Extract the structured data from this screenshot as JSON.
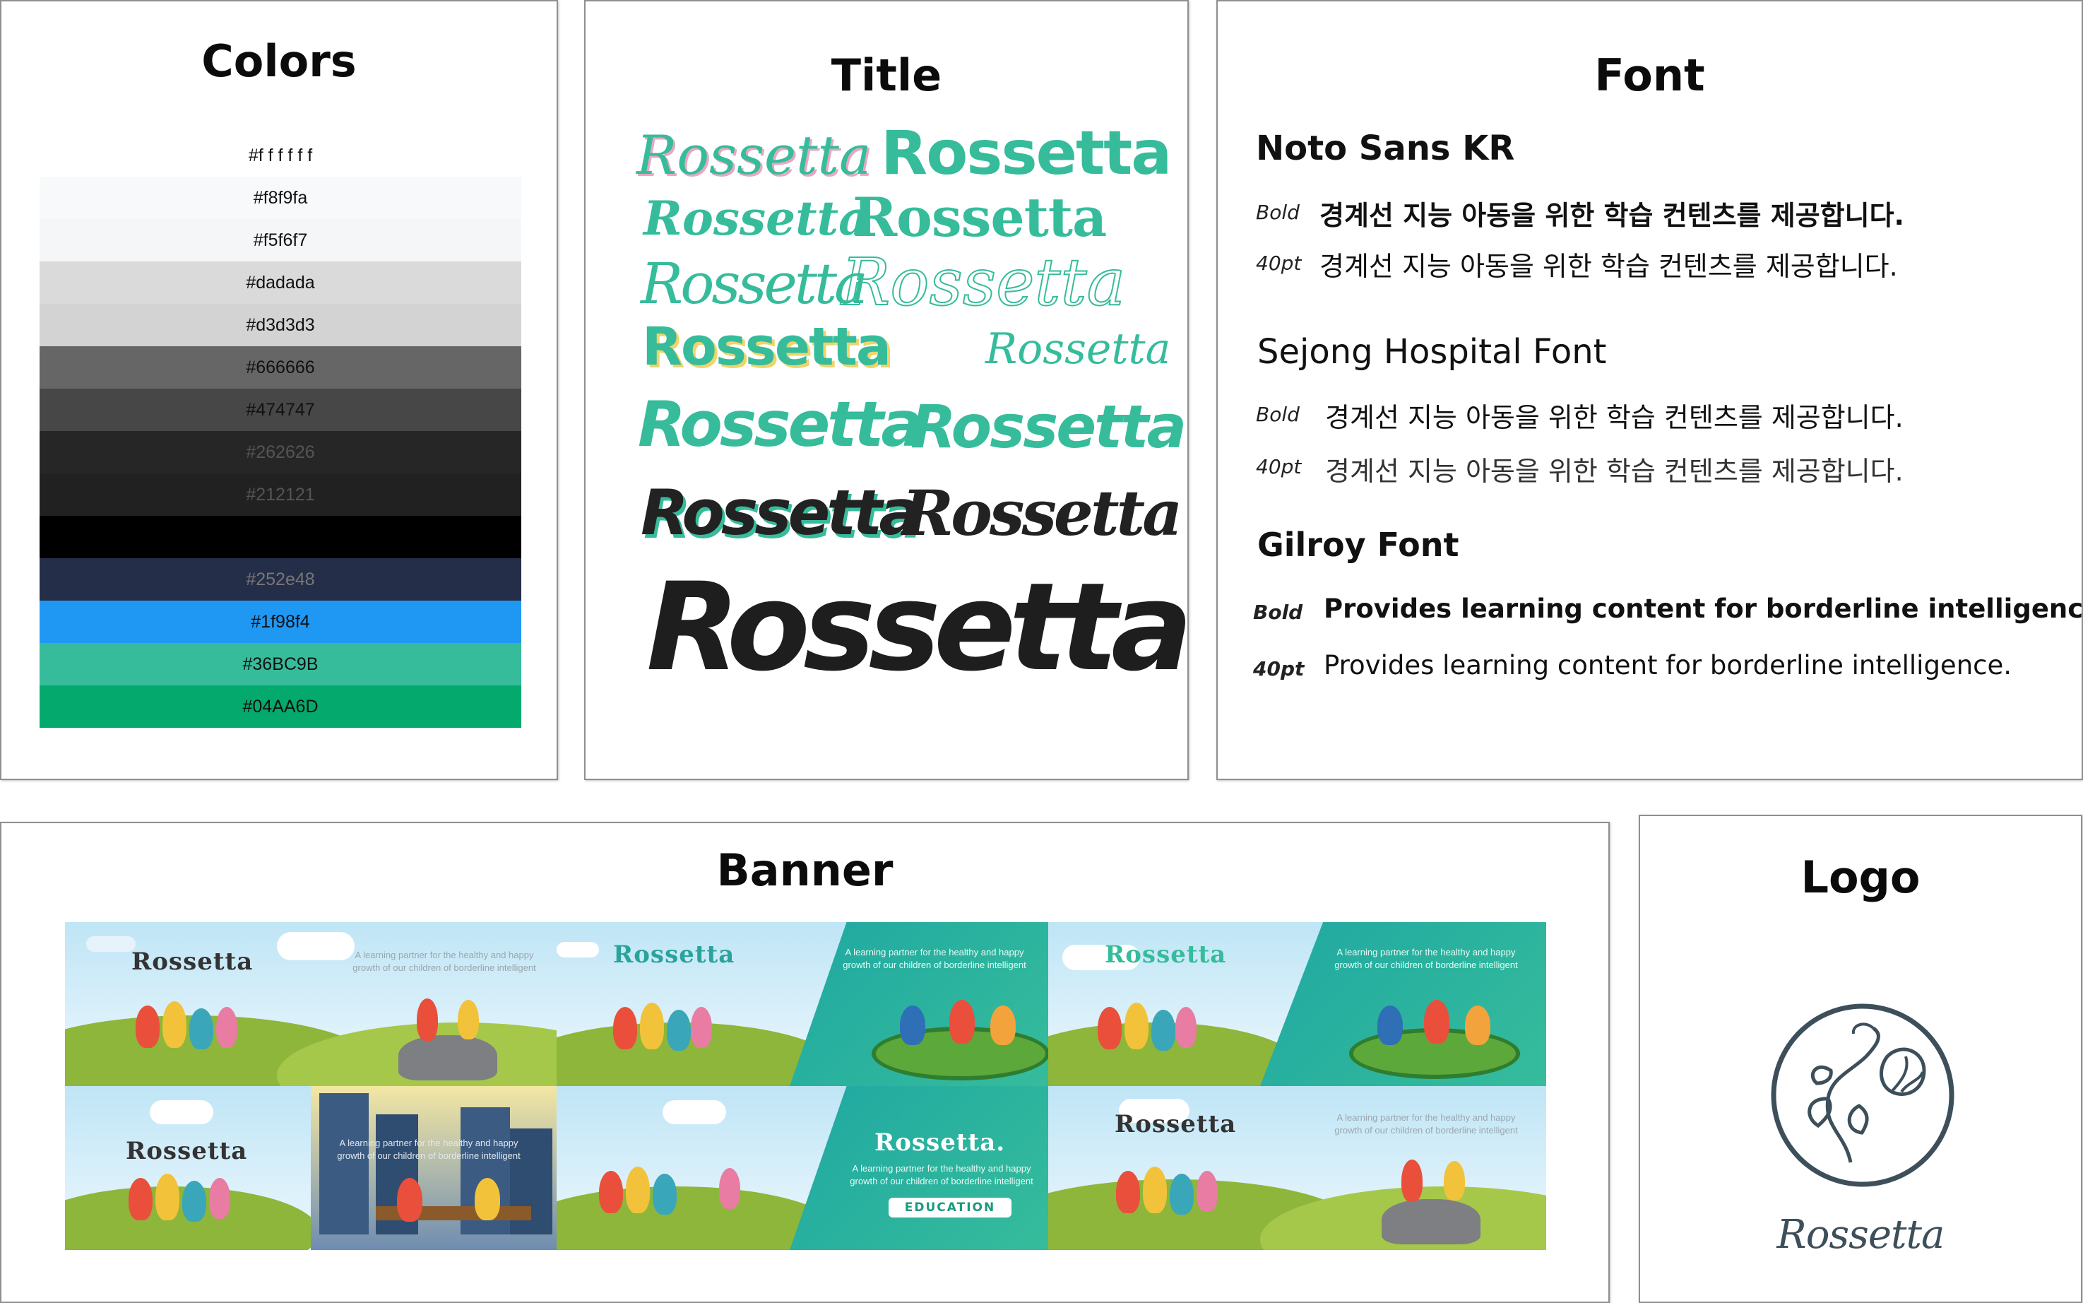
{
  "colors": {
    "title": "Colors",
    "swatches": [
      {
        "hex": "#ffffff",
        "label": "#f f f f f f",
        "text": "#111111"
      },
      {
        "hex": "#f8f9fa",
        "label": "#f8f9fa",
        "text": "#111111"
      },
      {
        "hex": "#f5f6f7",
        "label": "#f5f6f7",
        "text": "#111111"
      },
      {
        "hex": "#dadada",
        "label": "#dadada",
        "text": "#111111"
      },
      {
        "hex": "#d3d3d3",
        "label": "#d3d3d3",
        "text": "#111111"
      },
      {
        "hex": "#666666",
        "label": "#666666",
        "text": "#111111"
      },
      {
        "hex": "#474747",
        "label": "#474747",
        "text": "#111111"
      },
      {
        "hex": "#262626",
        "label": "#262626",
        "text": "#555555"
      },
      {
        "hex": "#212121",
        "label": "#212121",
        "text": "#555555"
      },
      {
        "hex": "#000000",
        "label": "",
        "text": "#555555"
      },
      {
        "hex": "#252e48",
        "label": "#252e48",
        "text": "#777777"
      },
      {
        "hex": "#1f98f4",
        "label": "#1f98f4",
        "text": "#111111"
      },
      {
        "hex": "#36bc9b",
        "label": "#36BC9B",
        "text": "#111111"
      },
      {
        "hex": "#04aa6d",
        "label": "#04AA6D",
        "text": "#111111"
      }
    ]
  },
  "title_panel": {
    "title": "Title",
    "word": "Rossetta"
  },
  "font_panel": {
    "title": "Font",
    "fonts": [
      {
        "name": "Noto Sans KR",
        "bold_tag": "Bold",
        "bold_sample": "경계선 지능 아동을 위한 학습 컨텐츠를 제공합니다.",
        "size_tag": "40pt",
        "size_sample": "경계선 지능 아동을 위한 학습 컨텐츠를 제공합니다."
      },
      {
        "name": "Sejong Hospital Font",
        "bold_tag": "Bold",
        "bold_sample": "경계선 지능 아동을 위한 학습 컨텐츠를 제공합니다.",
        "size_tag": "40pt",
        "size_sample": "경계선 지능 아동을 위한 학습 컨텐츠를 제공합니다."
      },
      {
        "name": "Gilroy Font",
        "bold_tag": "Bold",
        "bold_sample": "Provides learning content for borderline intelligence.",
        "size_tag": "40pt",
        "size_sample": "Provides learning content for borderline intelligence."
      }
    ]
  },
  "banner_panel": {
    "title": "Banner",
    "brand": "Rossetta",
    "brand_dot": "Rossetta.",
    "tagline": "A learning partner for the healthy and happy growth of our children of borderline intelligent",
    "education": "EDUCATION"
  },
  "logo_panel": {
    "title": "Logo",
    "wordmark": "Rossetta",
    "color": "#3c4f5a"
  },
  "accent": "#36bc9b"
}
